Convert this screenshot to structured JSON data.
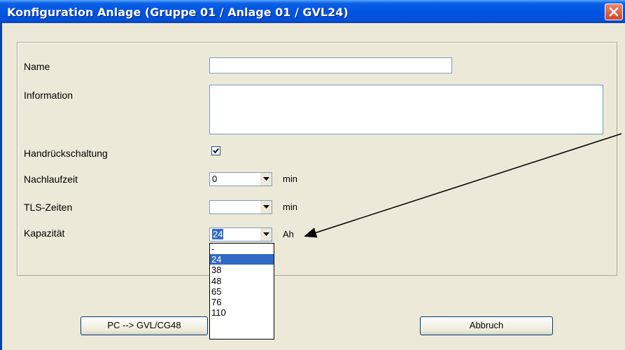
{
  "window": {
    "title": "Konfiguration Anlage (Gruppe 01 / Anlage 01 / GVL24)"
  },
  "form": {
    "name_label": "Name",
    "name_value": "",
    "information_label": "Information",
    "information_value": "",
    "handrueck_label": "Handrückschaltung",
    "handrueck_checked": true,
    "nachlauf_label": "Nachlaufzeit",
    "nachlauf_value": "0",
    "nachlauf_unit": "min",
    "tls_label": "TLS-Zeiten",
    "tls_value": "",
    "tls_unit": "min",
    "kapazitaet_label": "Kapazität",
    "kapazitaet_value": "24",
    "kapazitaet_unit": "Ah"
  },
  "kapazitaet_options": [
    "-",
    "24",
    "38",
    "48",
    "65",
    "76",
    "110"
  ],
  "kapazitaet_selected_index": 1,
  "buttons": {
    "transfer": "PC --> GVL/CG48",
    "cancel": "Abbruch"
  },
  "colors": {
    "titlebar": "#0054e3",
    "dialog_bg": "#ece9d8",
    "selection": "#316ac5",
    "close": "#d0452b"
  },
  "icons": {
    "close": "close-icon",
    "dropdown": "chevron-down-icon",
    "check": "check-icon",
    "annotation": "annotation-arrow"
  }
}
